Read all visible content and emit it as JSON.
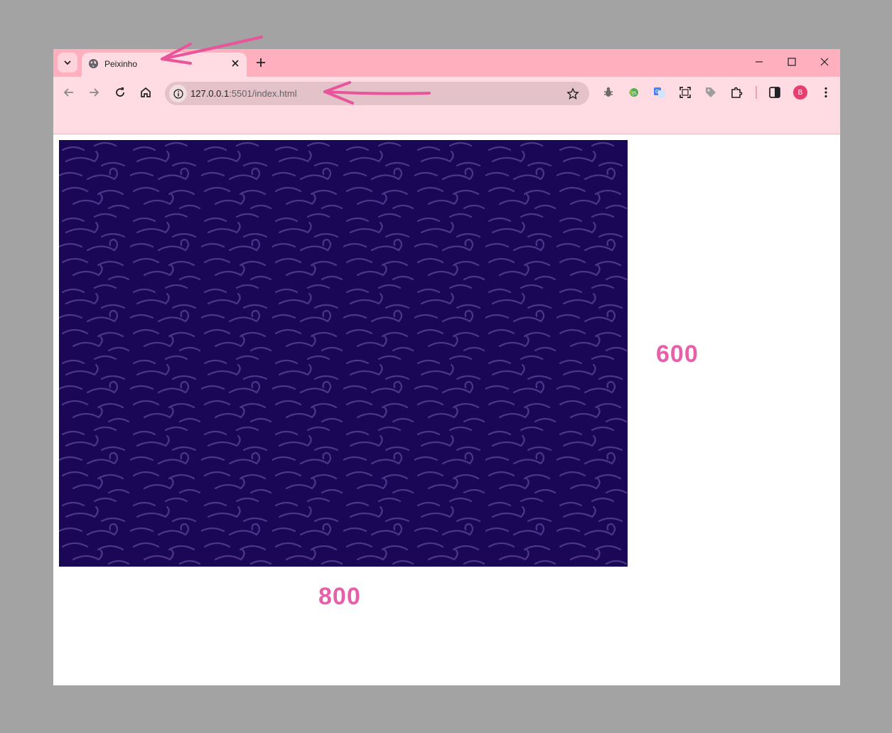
{
  "tab": {
    "title": "Peixinho"
  },
  "address_bar": {
    "host": "127.0.0.1",
    "path": ":5501/index.html"
  },
  "profile": {
    "initial": "B"
  },
  "annotations": {
    "height_label": "600",
    "width_label": "800"
  },
  "canvas": {
    "width": 800,
    "height": 600
  },
  "colors": {
    "tabstrip": "#ffafbe",
    "toolbar": "#ffdce3",
    "canvas_bg": "#1a0857",
    "wave_lines": "#4a3787",
    "annotation": "#e65fa8"
  },
  "icons": [
    "tab-search-icon",
    "globe-icon",
    "close-icon",
    "plus-icon",
    "minimize-icon",
    "maximize-icon",
    "close-window-icon",
    "back-icon",
    "forward-icon",
    "reload-icon",
    "home-icon",
    "info-icon",
    "star-icon",
    "bug-extension-icon",
    "js-extension-icon",
    "translate-extension-icon",
    "screenshot-extension-icon",
    "tag-extension-icon",
    "extensions-puzzle-icon",
    "side-panel-icon",
    "menu-dots-icon"
  ]
}
